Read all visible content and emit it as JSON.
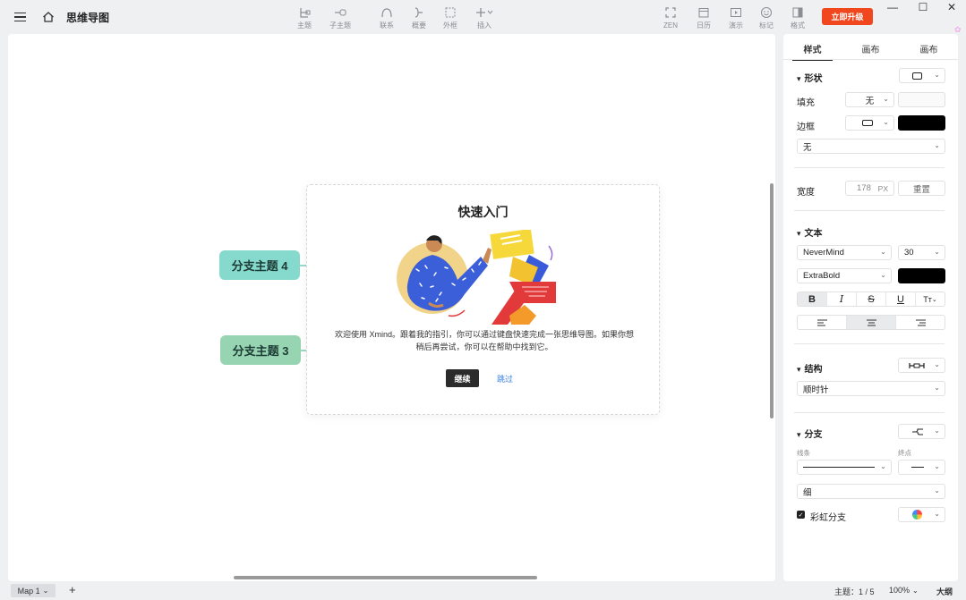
{
  "app": {
    "doc_title": "思维导图",
    "upgrade_label": "立即升级"
  },
  "toolbar": {
    "items": [
      {
        "label": "主题",
        "icon": "topic-icon"
      },
      {
        "label": "子主题",
        "icon": "subtopic-icon"
      },
      {
        "label": "联系",
        "icon": "relationship-icon"
      },
      {
        "label": "概要",
        "icon": "summary-icon"
      },
      {
        "label": "外框",
        "icon": "boundary-icon"
      },
      {
        "label": "插入",
        "icon": "insert-plus-icon"
      }
    ],
    "right_items": [
      {
        "label": "ZEN",
        "icon": "zen-icon"
      },
      {
        "label": "日历",
        "icon": "calendar-icon"
      },
      {
        "label": "演示",
        "icon": "present-icon"
      },
      {
        "label": "标记",
        "icon": "marker-icon"
      },
      {
        "label": "格式",
        "icon": "format-panel-icon"
      }
    ]
  },
  "canvas": {
    "branches": [
      {
        "label": "分支主题 4",
        "color": "#86d9cd"
      },
      {
        "label": "分支主题 3",
        "color": "#97d4b1"
      }
    ]
  },
  "modal": {
    "title": "快速入门",
    "body": "欢迎使用 Xmind。跟着我的指引，你可以通过键盘快速完成一张思维导图。如果你想稍后再尝试，你可以在帮助中找到它。",
    "continue_label": "继续",
    "skip_label": "跳过"
  },
  "panel": {
    "tabs": [
      "样式",
      "画布",
      "画布"
    ],
    "shape": {
      "title": "形状"
    },
    "fill": {
      "label": "填充",
      "value": "无"
    },
    "border": {
      "label": "边框",
      "sub_value": "无"
    },
    "width": {
      "label": "宽度",
      "value": "178",
      "unit": "PX",
      "reset_label": "重置"
    },
    "text": {
      "title": "文本",
      "font": "NeverMind",
      "size": "30",
      "weight": "ExtraBold",
      "bold": "B",
      "italic": "I",
      "strike": "S",
      "underline": "U",
      "case": "Tт"
    },
    "structure": {
      "title": "结构",
      "value": "顺时针"
    },
    "branch": {
      "title": "分支",
      "line_caption": "线条",
      "end_caption": "终点",
      "width_value": "细",
      "rainbow_label": "彩虹分支"
    }
  },
  "status": {
    "sheet": "Map 1",
    "topics": "主题：1 / 5",
    "zoom": "100%",
    "outline": "大纲"
  },
  "colors": {
    "accent": "#f0471e",
    "modal_button": "#2b2b2b",
    "link": "#3a80e0"
  }
}
